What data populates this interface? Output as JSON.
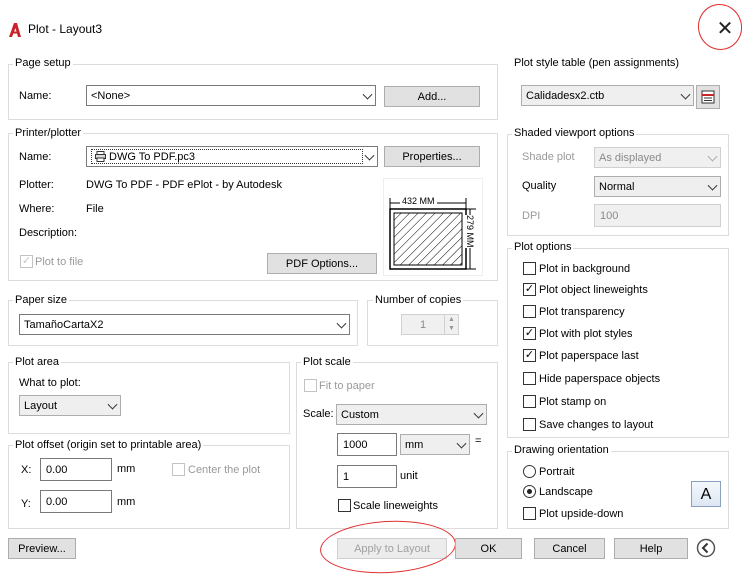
{
  "window": {
    "title": "Plot - Layout3",
    "close_icon": "close-icon"
  },
  "page_setup": {
    "group_title": "Page setup",
    "name_label": "Name:",
    "name_value": "<None>",
    "add_button": "Add..."
  },
  "printer": {
    "group_title": "Printer/plotter",
    "name_label": "Name:",
    "name_value": "DWG To PDF.pc3",
    "properties_button": "Properties...",
    "plotter_label": "Plotter:",
    "plotter_value": "DWG To PDF - PDF ePlot - by Autodesk",
    "where_label": "Where:",
    "where_value": "File",
    "description_label": "Description:",
    "plot_to_file_label": "Plot to file",
    "plot_to_file_checked": true,
    "pdf_options_button": "PDF Options...",
    "preview_width": "432 MM",
    "preview_height": "279 MM"
  },
  "paper_size": {
    "group_title": "Paper size",
    "value": "TamañoCartaX2"
  },
  "copies": {
    "group_title": "Number of copies",
    "value": "1"
  },
  "plot_area": {
    "group_title": "Plot area",
    "what_label": "What to plot:",
    "what_value": "Layout"
  },
  "plot_offset": {
    "group_title": "Plot offset (origin set to printable area)",
    "x_label": "X:",
    "x_value": "0.00",
    "x_unit": "mm",
    "y_label": "Y:",
    "y_value": "0.00",
    "y_unit": "mm",
    "center_label": "Center the plot",
    "center_checked": false
  },
  "plot_scale": {
    "group_title": "Plot scale",
    "fit_label": "Fit to paper",
    "fit_checked": false,
    "scale_label": "Scale:",
    "scale_value": "Custom",
    "top_value": "1000",
    "top_unit": "mm",
    "equals": "=",
    "bottom_value": "1",
    "bottom_unit": "unit",
    "lineweights_label": "Scale lineweights",
    "lineweights_checked": false
  },
  "plot_style_table": {
    "group_title": "Plot style table (pen assignments)",
    "value": "Calidadesx2.ctb",
    "edit_icon": "edit-table-icon"
  },
  "shaded": {
    "group_title": "Shaded viewport options",
    "shade_label": "Shade plot",
    "shade_value": "As displayed",
    "quality_label": "Quality",
    "quality_value": "Normal",
    "dpi_label": "DPI",
    "dpi_value": "100"
  },
  "plot_options": {
    "group_title": "Plot options",
    "items": [
      {
        "label": "Plot in background",
        "checked": false
      },
      {
        "label": "Plot object lineweights",
        "checked": true
      },
      {
        "label": "Plot transparency",
        "checked": false
      },
      {
        "label": "Plot with plot styles",
        "checked": true
      },
      {
        "label": "Plot paperspace last",
        "checked": true
      },
      {
        "label": "Hide paperspace objects",
        "checked": false
      },
      {
        "label": "Plot stamp on",
        "checked": false
      },
      {
        "label": "Save changes to layout",
        "checked": false
      }
    ]
  },
  "orientation": {
    "group_title": "Drawing orientation",
    "portrait_label": "Portrait",
    "landscape_label": "Landscape",
    "selected": "Landscape",
    "upside_label": "Plot upside-down",
    "upside_checked": false,
    "icon_letter": "A"
  },
  "footer": {
    "preview_button": "Preview...",
    "apply_button": "Apply to Layout",
    "ok_button": "OK",
    "cancel_button": "Cancel",
    "help_button": "Help",
    "more_icon": "chevron-left-circle-icon"
  },
  "colors": {
    "accent_red": "#c8242b",
    "annotation_red": "#e03030",
    "group_border": "#dcdcdc"
  }
}
